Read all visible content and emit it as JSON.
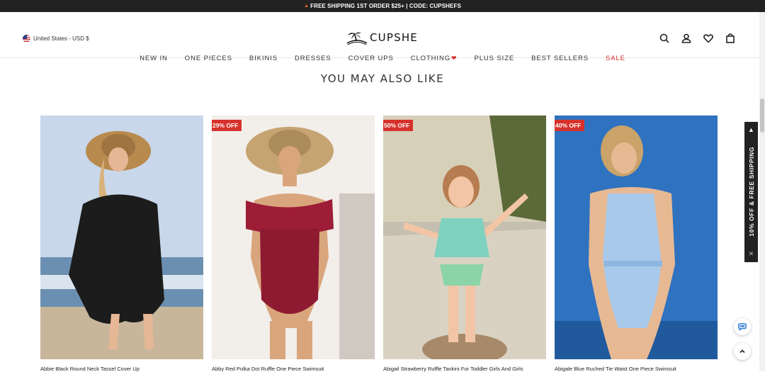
{
  "promo": {
    "text": "FREE SHIPPING 1ST ORDER $25+ | CODE: CUPSHEFS",
    "icon": "flame-icon"
  },
  "locale": {
    "label": "United States - USD $",
    "icon": "us-flag-icon"
  },
  "brand": {
    "name": "CUPSHE",
    "icon": "palm-island-logo"
  },
  "toolbar": {
    "icons": [
      "search-icon",
      "account-icon",
      "heart-icon",
      "bag-icon"
    ]
  },
  "nav": {
    "items": [
      {
        "label": "NEW IN"
      },
      {
        "label": "ONE PIECES"
      },
      {
        "label": "BIKINIS"
      },
      {
        "label": "DRESSES"
      },
      {
        "label": "COVER UPS"
      },
      {
        "label": "CLOTHING",
        "icon": "heart-icon"
      },
      {
        "label": "PLUS SIZE"
      },
      {
        "label": "BEST SELLERS"
      },
      {
        "label": "SALE"
      }
    ]
  },
  "section": {
    "title": "YOU MAY ALSO LIKE"
  },
  "products": [
    {
      "name": "Abbie Black Round Neck Tassel Cover Up",
      "badge": ""
    },
    {
      "name": "Abby Red Polka Dot Ruffle One Piece Swimsuit",
      "badge": "29% OFF"
    },
    {
      "name": "Abigail Strawberry Ruffle Tankini For Toddler Girls And Girls",
      "badge": "50% OFF"
    },
    {
      "name": "Abigale Blue Ruched Tie Waist One Piece Swimsuit",
      "badge": "40% OFF"
    }
  ],
  "side_tab": {
    "text": "10% OFF & FREE SHIPPING",
    "close_icon": "close-icon",
    "arrow_icon": "triangle-up-icon"
  },
  "floating": {
    "chat_icon": "chat-icon",
    "top_icon": "chevron-up-icon"
  },
  "colors": {
    "sale": "#d12b2b",
    "badge": "#d6322b",
    "promo_bg": "#222222",
    "chat": "#2e7fd6"
  }
}
